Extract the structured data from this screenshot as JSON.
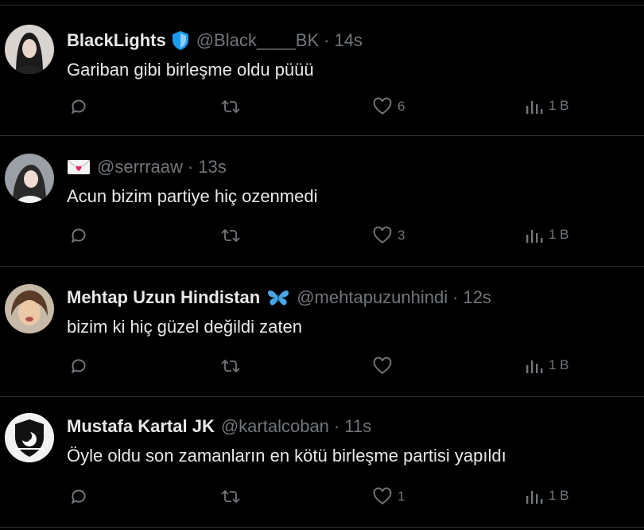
{
  "tweets": [
    {
      "name": "BlackLights",
      "badge": "blue-shield",
      "handle": "@Black____BK",
      "time": "14s",
      "text": "Gariban gibi birleşme oldu püüü",
      "likes": "6",
      "views": "1 B"
    },
    {
      "name": "",
      "badge": "envelope-emoji",
      "handle": "@serrraaw",
      "time": "13s",
      "text": "Acun bizim partiye hiç ozenmedi",
      "likes": "3",
      "views": "1 B"
    },
    {
      "name": "Mehtap Uzun Hindistan",
      "badge": "butterfly-emoji",
      "handle": "@mehtapuzunhindi",
      "time": "12s",
      "text": "bizim ki hiç güzel değildi zaten",
      "likes": "",
      "views": "1 B"
    },
    {
      "name": "Mustafa Kartal JK",
      "badge": "",
      "handle": "@kartalcoban",
      "time": "11s",
      "text": "Öyle oldu son zamanların en kötü birleşme partisi yapıldı",
      "likes": "1",
      "views": "1 B"
    }
  ],
  "separator": "·",
  "colors": {
    "background": "#000000",
    "text": "#e7e9ea",
    "muted": "#71767b",
    "divider": "#2f3336"
  }
}
